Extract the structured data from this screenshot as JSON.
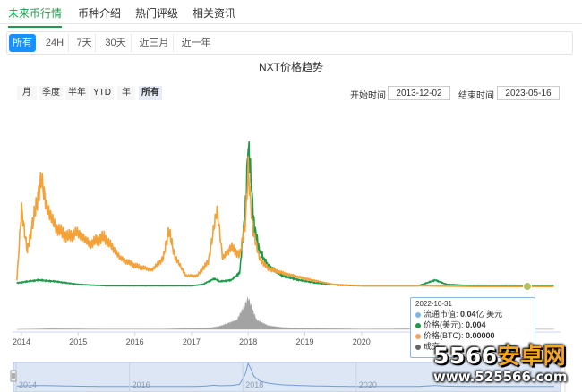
{
  "top_tabs": [
    "未来币行情",
    "币种介绍",
    "热门评级",
    "相关资讯"
  ],
  "range_tabs": [
    "所有",
    "24H",
    "7天",
    "30天",
    "近三月",
    "近一年"
  ],
  "chart_title": "NXT价格趋势",
  "period_tabs": [
    "月",
    "季度",
    "半年",
    "YTD",
    "年",
    "所有"
  ],
  "start_label": "开始时间",
  "start_date": "2013-12-02",
  "end_label": "结束时间",
  "end_date": "2023-05-16",
  "tooltip": {
    "date": "2022-10-31",
    "rows": [
      {
        "label": "流通市值:",
        "value": "0.04",
        "unit": "亿 美元",
        "color": "#7cb5ec"
      },
      {
        "label": "价格(美元):",
        "value": "0.004",
        "unit": "",
        "color": "#1e9a4a"
      },
      {
        "label": "价格(BTC):",
        "value": "0.00000",
        "unit": "",
        "color": "#f7a35c"
      },
      {
        "label": "成交",
        "value": "",
        "unit": "",
        "color": "#666666"
      }
    ]
  },
  "watermark": {
    "main_a": "5566",
    "main_b": "安卓网",
    "url": "www.525566.com"
  },
  "colors": {
    "usd": "#1e9a4a",
    "btc": "#f4a137",
    "volume": "#9a9a9a",
    "navigator": "#a8c4e8",
    "accent": "#1890ff"
  },
  "chart_data": {
    "type": "line",
    "title": "NXT价格趋势",
    "x_ticks": [
      "2014",
      "2015",
      "2016",
      "2017",
      "2018",
      "2019",
      "2020"
    ],
    "navigator_ticks": [
      "2014",
      "2016",
      "2018",
      "2020"
    ],
    "y_axis_labels": "none",
    "series": [
      {
        "name": "价格(美元)",
        "relative_level_points": [
          [
            2013.92,
            0.03
          ],
          [
            2014.1,
            0.04
          ],
          [
            2014.3,
            0.05
          ],
          [
            2014.6,
            0.04
          ],
          [
            2015.0,
            0.02
          ],
          [
            2015.5,
            0.01
          ],
          [
            2016.0,
            0.01
          ],
          [
            2016.5,
            0.01
          ],
          [
            2017.0,
            0.01
          ],
          [
            2017.2,
            0.02
          ],
          [
            2017.4,
            0.06
          ],
          [
            2017.5,
            0.04
          ],
          [
            2017.7,
            0.05
          ],
          [
            2017.85,
            0.1
          ],
          [
            2017.95,
            0.55
          ],
          [
            2018.0,
            1.0
          ],
          [
            2018.05,
            0.75
          ],
          [
            2018.1,
            0.45
          ],
          [
            2018.2,
            0.25
          ],
          [
            2018.35,
            0.15
          ],
          [
            2018.6,
            0.08
          ],
          [
            2018.9,
            0.05
          ],
          [
            2019.2,
            0.03
          ],
          [
            2019.6,
            0.015
          ],
          [
            2020.0,
            0.01
          ],
          [
            2020.5,
            0.01
          ],
          [
            2021.0,
            0.01
          ],
          [
            2021.3,
            0.05
          ],
          [
            2021.5,
            0.02
          ],
          [
            2022.0,
            0.01
          ],
          [
            2023.4,
            0.01
          ]
        ]
      },
      {
        "name": "价格(BTC)",
        "relative_level_points": [
          [
            2013.92,
            0.05
          ],
          [
            2014.0,
            0.55
          ],
          [
            2014.1,
            0.25
          ],
          [
            2014.2,
            0.45
          ],
          [
            2014.35,
            0.75
          ],
          [
            2014.45,
            0.55
          ],
          [
            2014.6,
            0.42
          ],
          [
            2014.8,
            0.35
          ],
          [
            2015.0,
            0.38
          ],
          [
            2015.2,
            0.3
          ],
          [
            2015.45,
            0.35
          ],
          [
            2015.6,
            0.28
          ],
          [
            2015.75,
            0.2
          ],
          [
            2016.0,
            0.15
          ],
          [
            2016.3,
            0.12
          ],
          [
            2016.5,
            0.2
          ],
          [
            2016.6,
            0.4
          ],
          [
            2016.7,
            0.22
          ],
          [
            2016.9,
            0.08
          ],
          [
            2017.1,
            0.08
          ],
          [
            2017.3,
            0.18
          ],
          [
            2017.45,
            0.55
          ],
          [
            2017.55,
            0.2
          ],
          [
            2017.7,
            0.28
          ],
          [
            2017.85,
            0.22
          ],
          [
            2017.95,
            0.45
          ],
          [
            2018.0,
            0.82
          ],
          [
            2018.08,
            0.4
          ],
          [
            2018.2,
            0.2
          ],
          [
            2018.35,
            0.13
          ],
          [
            2018.6,
            0.1
          ],
          [
            2019.0,
            0.06
          ],
          [
            2019.5,
            0.02
          ],
          [
            2020.0,
            0.01
          ],
          [
            2021.0,
            0.01
          ],
          [
            2022.0,
            0.005
          ],
          [
            2023.4,
            0.005
          ]
        ]
      },
      {
        "name": "成交",
        "relative_level_points": [
          [
            2013.92,
            0.0
          ],
          [
            2014.5,
            0.02
          ],
          [
            2015.5,
            0.01
          ],
          [
            2016.5,
            0.01
          ],
          [
            2017.3,
            0.04
          ],
          [
            2017.5,
            0.1
          ],
          [
            2017.8,
            0.3
          ],
          [
            2017.95,
            0.8
          ],
          [
            2018.0,
            1.0
          ],
          [
            2018.05,
            0.75
          ],
          [
            2018.15,
            0.3
          ],
          [
            2018.35,
            0.12
          ],
          [
            2018.6,
            0.06
          ],
          [
            2019.0,
            0.03
          ],
          [
            2020.0,
            0.01
          ],
          [
            2021.3,
            0.02
          ],
          [
            2023.4,
            0.005
          ]
        ]
      }
    ]
  }
}
